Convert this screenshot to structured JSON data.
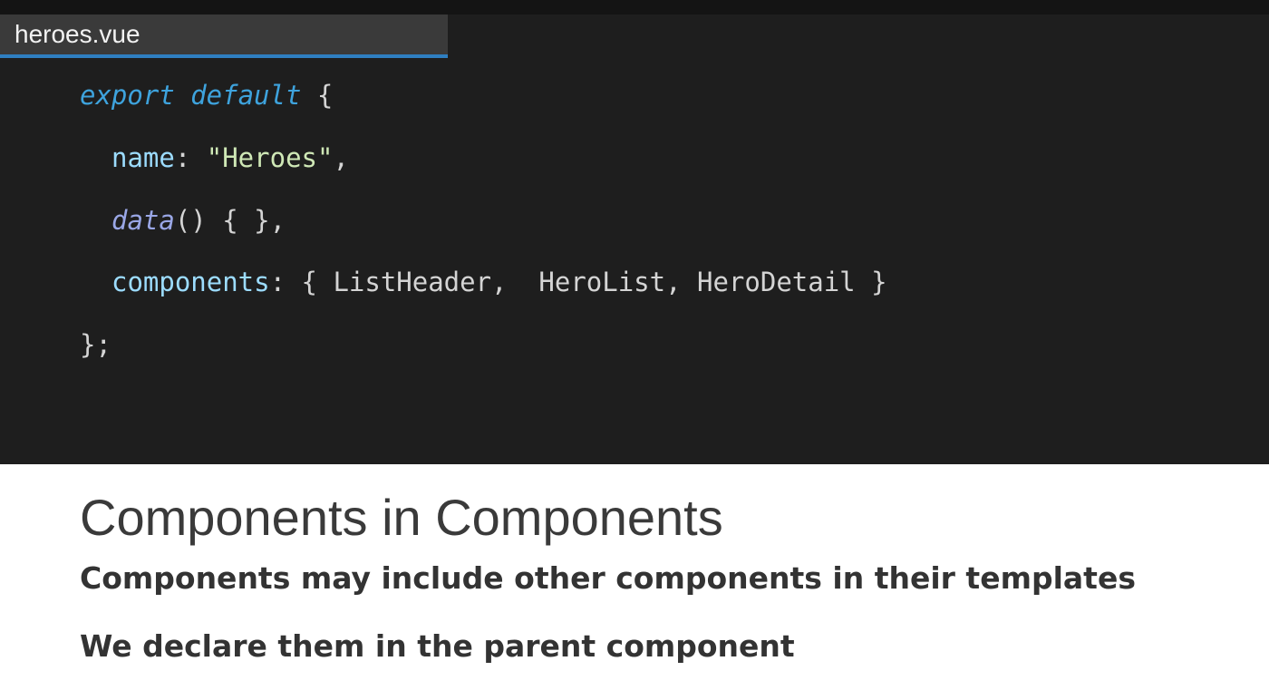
{
  "file_tab": {
    "filename": "heroes.vue"
  },
  "code": {
    "line1": {
      "keyword": "export default",
      "rest": " {"
    },
    "line2": {
      "prop": "name",
      "sep": ": ",
      "value": "\"Heroes\"",
      "end": ","
    },
    "line3": {
      "fn": "data",
      "rest": "() { },"
    },
    "line4": {
      "prop": "components",
      "sep": ": ",
      "rest": "{ ListHeader,  HeroList, HeroDetail }"
    },
    "line5": {
      "text": "};"
    }
  },
  "slide": {
    "title": "Components in Components",
    "bullets": [
      "Components may include other components in their templates",
      "We declare them in the parent component"
    ]
  },
  "colors": {
    "tab_accent": "#2f7fc1",
    "keyword": "#3ea3dd",
    "property": "#9cdcfe",
    "string": "#cfe8b6",
    "code_background": "#1e1e1e"
  }
}
